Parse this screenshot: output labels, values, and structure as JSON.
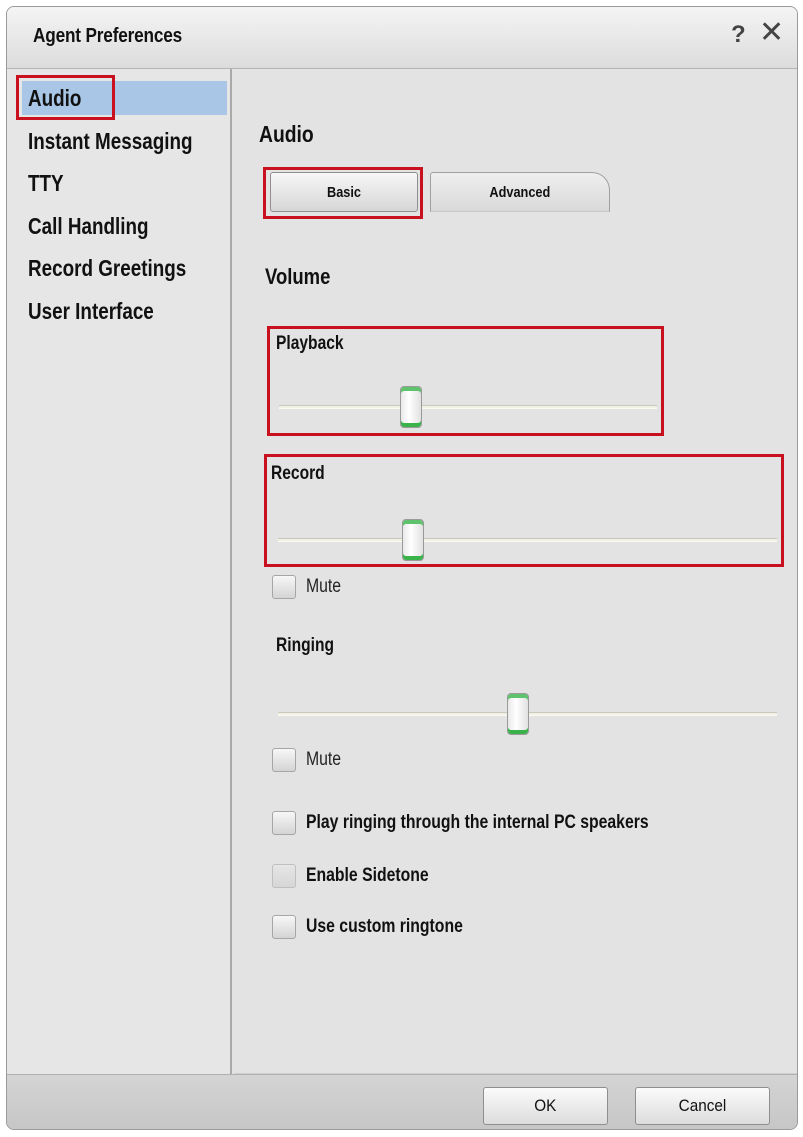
{
  "window": {
    "title": "Agent Preferences",
    "help_label": "?",
    "close_label": "✕"
  },
  "sidebar": {
    "items": [
      {
        "label": "Audio",
        "selected": true
      },
      {
        "label": "Instant Messaging"
      },
      {
        "label": "TTY"
      },
      {
        "label": "Call Handling"
      },
      {
        "label": "Record Greetings"
      },
      {
        "label": "User Interface"
      }
    ]
  },
  "audio": {
    "title": "Audio",
    "tabs": [
      {
        "label": "Basic",
        "active": true
      },
      {
        "label": "Advanced"
      }
    ],
    "volume_title": "Volume",
    "playback": {
      "label": "Playback",
      "level": 0.35
    },
    "record": {
      "label": "Record",
      "level": 0.27
    },
    "record_mute": {
      "label": "Mute",
      "checked": false
    },
    "ringing": {
      "label": "Ringing",
      "level": 0.48
    },
    "ringing_mute": {
      "label": "Mute",
      "checked": false
    },
    "options": [
      {
        "label": "Play ringing through the internal PC speakers",
        "checked": false,
        "enabled": true
      },
      {
        "label": "Enable Sidetone",
        "checked": false,
        "enabled": false
      },
      {
        "label": "Use custom ringtone",
        "checked": false,
        "enabled": true
      }
    ]
  },
  "footer": {
    "ok_label": "OK",
    "cancel_label": "Cancel"
  },
  "colors": {
    "highlight_box": "#c8101e",
    "selected_item": "#a9c6e6",
    "slider_thumb_accent": "#39b34a"
  }
}
